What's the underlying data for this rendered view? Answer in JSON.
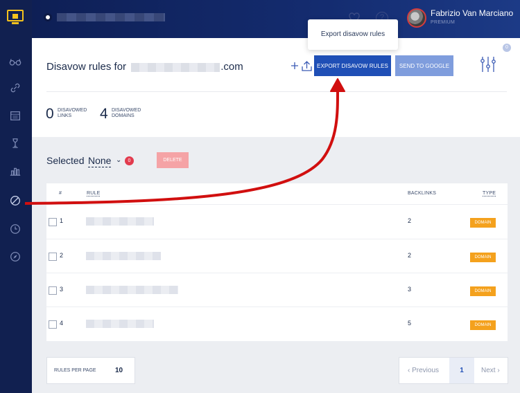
{
  "topbar": {
    "user_name": "Fabrizio Van Marciano",
    "user_plan": "PREMIUM",
    "caret": "⌄",
    "help": "?"
  },
  "header": {
    "title_prefix": "Disavow rules for ",
    "title_suffix": ".com",
    "export_button": "EXPORT DISAVOW RULES",
    "google_button": "SEND TO GOOGLE",
    "filter_badge": "0",
    "tooltip": "Export disavow rules"
  },
  "stats": {
    "links_count": "0",
    "links_label_1": "DISAVOWED",
    "links_label_2": "LINKS",
    "domains_count": "4",
    "domains_label_1": "DISAVOWED",
    "domains_label_2": "DOMAINS"
  },
  "selection": {
    "label": "Selected",
    "value": "None",
    "chevron": "⌄",
    "badge": "0",
    "delete_button": "DELETE"
  },
  "table": {
    "headers": {
      "num": "#",
      "rule": "RULE",
      "backlinks": "BACKLINKS",
      "type": "TYPE"
    },
    "rows": [
      {
        "num": "1",
        "backlinks": "2",
        "type": "DOMAIN"
      },
      {
        "num": "2",
        "backlinks": "2",
        "type": "DOMAIN"
      },
      {
        "num": "3",
        "backlinks": "3",
        "type": "DOMAIN"
      },
      {
        "num": "4",
        "backlinks": "5",
        "type": "DOMAIN"
      }
    ]
  },
  "footer": {
    "rules_per_page_label": "RULES PER PAGE",
    "rules_per_page_value": "10",
    "prev": "‹ Previous",
    "current_page": "1",
    "next": "Next ›"
  },
  "colors": {
    "sidebar": "#112050",
    "primary_button": "#1f4fb6",
    "secondary_button": "#7f9ddd",
    "delete_button": "#f5a3a6",
    "type_badge": "#f4a11d",
    "annotation_arrow": "#d10f0f"
  },
  "icons": {
    "sidebar": [
      "glasses-icon",
      "link-icon",
      "calendar-icon",
      "tower-icon",
      "bar-chart-icon",
      "disavow-icon",
      "clock-icon",
      "compass-icon"
    ]
  }
}
